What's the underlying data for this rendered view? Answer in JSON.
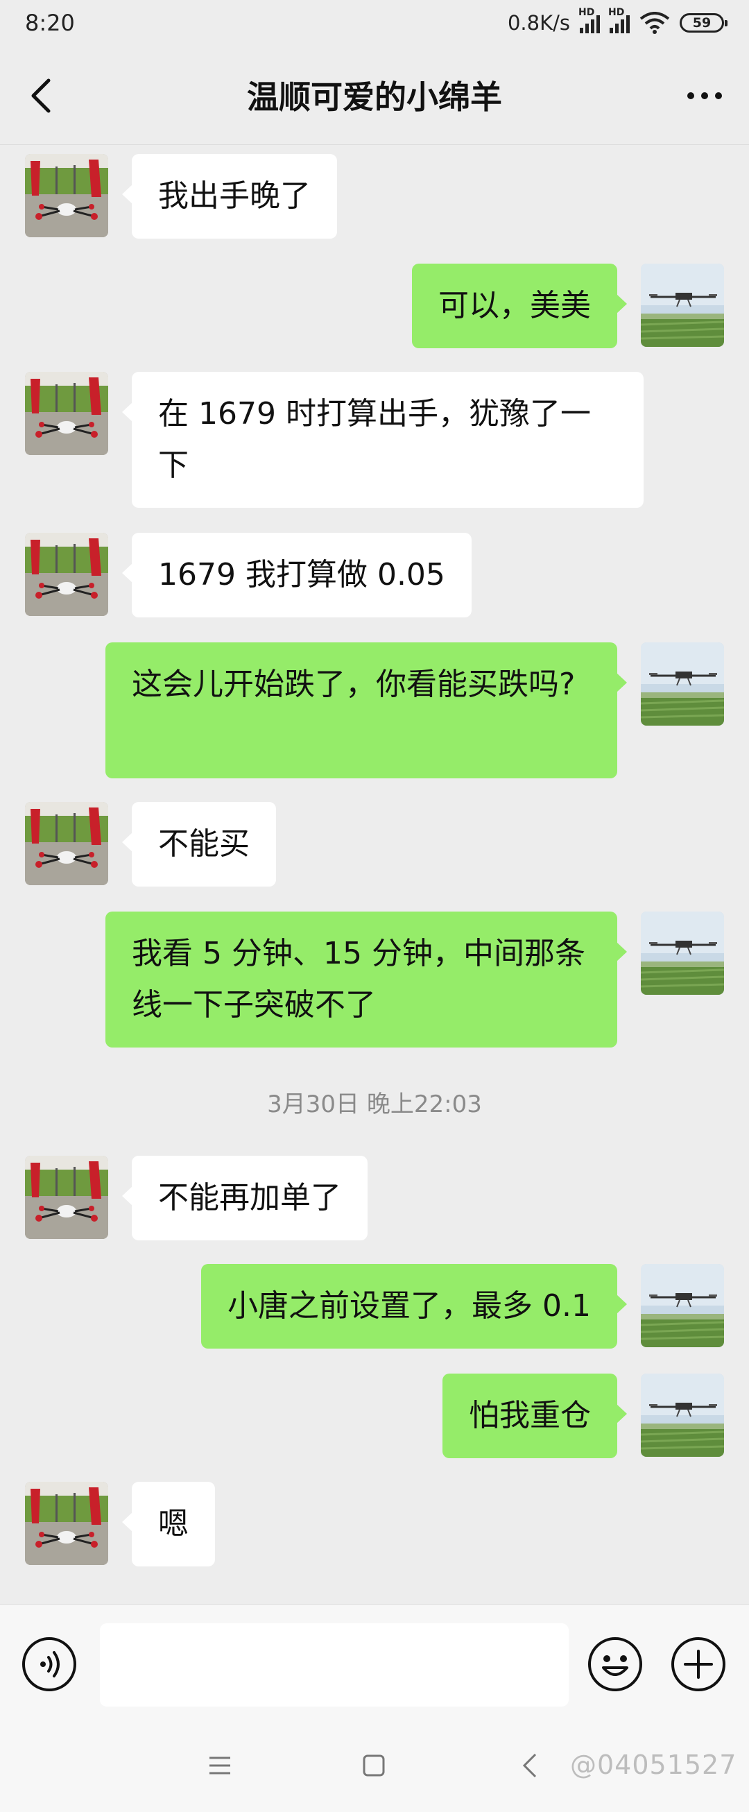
{
  "status_bar": {
    "time": "8:20",
    "speed": "0.8K/s",
    "signal_label": "HD",
    "battery": "59"
  },
  "header": {
    "title": "温顺可爱的小绵羊",
    "back_icon": "chevron-left-icon",
    "more_icon": "more-dots-icon"
  },
  "messages": [
    {
      "side": "recv",
      "text": "我出手晚了"
    },
    {
      "side": "sent",
      "text": "可以，美美"
    },
    {
      "side": "recv",
      "text": "在 1679 时打算出手，犹豫了一下"
    },
    {
      "side": "recv",
      "text": "1679 我打算做 0.05"
    },
    {
      "side": "sent",
      "text": "这会儿开始跌了，你看能买跌吗?"
    },
    {
      "side": "recv",
      "text": "不能买"
    },
    {
      "side": "sent",
      "text": "我看 5 分钟、15 分钟，中间那条线一下子突破不了"
    },
    {
      "side": "recv",
      "text": "不能再加单了"
    },
    {
      "side": "sent",
      "text": "小唐之前设置了，最多 0.1"
    },
    {
      "side": "sent",
      "text": "怕我重仓"
    },
    {
      "side": "recv",
      "text": "嗯"
    }
  ],
  "timestamp": "3月30日 晚上22:03",
  "input_bar": {
    "voice_icon": "voice-icon",
    "emoji_icon": "emoji-icon",
    "plus_icon": "plus-icon",
    "value": ""
  },
  "system_nav": {
    "menu_icon": "menu-icon",
    "home_icon": "home-icon",
    "back_icon": "back-icon",
    "watermark": "@04051527"
  },
  "colors": {
    "background": "#ededed",
    "sent_bubble": "#95ec69",
    "recv_bubble": "#ffffff",
    "timestamp": "#8a8a8a"
  }
}
